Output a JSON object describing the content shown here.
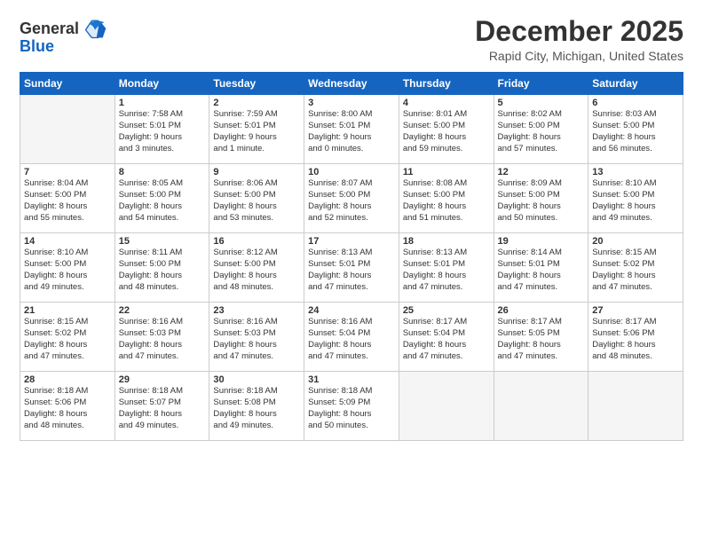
{
  "header": {
    "logo_line1": "General",
    "logo_line2": "Blue",
    "month": "December 2025",
    "location": "Rapid City, Michigan, United States"
  },
  "weekdays": [
    "Sunday",
    "Monday",
    "Tuesday",
    "Wednesday",
    "Thursday",
    "Friday",
    "Saturday"
  ],
  "weeks": [
    [
      {
        "day": "",
        "info": ""
      },
      {
        "day": "1",
        "info": "Sunrise: 7:58 AM\nSunset: 5:01 PM\nDaylight: 9 hours\nand 3 minutes."
      },
      {
        "day": "2",
        "info": "Sunrise: 7:59 AM\nSunset: 5:01 PM\nDaylight: 9 hours\nand 1 minute."
      },
      {
        "day": "3",
        "info": "Sunrise: 8:00 AM\nSunset: 5:01 PM\nDaylight: 9 hours\nand 0 minutes."
      },
      {
        "day": "4",
        "info": "Sunrise: 8:01 AM\nSunset: 5:00 PM\nDaylight: 8 hours\nand 59 minutes."
      },
      {
        "day": "5",
        "info": "Sunrise: 8:02 AM\nSunset: 5:00 PM\nDaylight: 8 hours\nand 57 minutes."
      },
      {
        "day": "6",
        "info": "Sunrise: 8:03 AM\nSunset: 5:00 PM\nDaylight: 8 hours\nand 56 minutes."
      }
    ],
    [
      {
        "day": "7",
        "info": "Sunrise: 8:04 AM\nSunset: 5:00 PM\nDaylight: 8 hours\nand 55 minutes."
      },
      {
        "day": "8",
        "info": "Sunrise: 8:05 AM\nSunset: 5:00 PM\nDaylight: 8 hours\nand 54 minutes."
      },
      {
        "day": "9",
        "info": "Sunrise: 8:06 AM\nSunset: 5:00 PM\nDaylight: 8 hours\nand 53 minutes."
      },
      {
        "day": "10",
        "info": "Sunrise: 8:07 AM\nSunset: 5:00 PM\nDaylight: 8 hours\nand 52 minutes."
      },
      {
        "day": "11",
        "info": "Sunrise: 8:08 AM\nSunset: 5:00 PM\nDaylight: 8 hours\nand 51 minutes."
      },
      {
        "day": "12",
        "info": "Sunrise: 8:09 AM\nSunset: 5:00 PM\nDaylight: 8 hours\nand 50 minutes."
      },
      {
        "day": "13",
        "info": "Sunrise: 8:10 AM\nSunset: 5:00 PM\nDaylight: 8 hours\nand 49 minutes."
      }
    ],
    [
      {
        "day": "14",
        "info": "Sunrise: 8:10 AM\nSunset: 5:00 PM\nDaylight: 8 hours\nand 49 minutes."
      },
      {
        "day": "15",
        "info": "Sunrise: 8:11 AM\nSunset: 5:00 PM\nDaylight: 8 hours\nand 48 minutes."
      },
      {
        "day": "16",
        "info": "Sunrise: 8:12 AM\nSunset: 5:00 PM\nDaylight: 8 hours\nand 48 minutes."
      },
      {
        "day": "17",
        "info": "Sunrise: 8:13 AM\nSunset: 5:01 PM\nDaylight: 8 hours\nand 47 minutes."
      },
      {
        "day": "18",
        "info": "Sunrise: 8:13 AM\nSunset: 5:01 PM\nDaylight: 8 hours\nand 47 minutes."
      },
      {
        "day": "19",
        "info": "Sunrise: 8:14 AM\nSunset: 5:01 PM\nDaylight: 8 hours\nand 47 minutes."
      },
      {
        "day": "20",
        "info": "Sunrise: 8:15 AM\nSunset: 5:02 PM\nDaylight: 8 hours\nand 47 minutes."
      }
    ],
    [
      {
        "day": "21",
        "info": "Sunrise: 8:15 AM\nSunset: 5:02 PM\nDaylight: 8 hours\nand 47 minutes."
      },
      {
        "day": "22",
        "info": "Sunrise: 8:16 AM\nSunset: 5:03 PM\nDaylight: 8 hours\nand 47 minutes."
      },
      {
        "day": "23",
        "info": "Sunrise: 8:16 AM\nSunset: 5:03 PM\nDaylight: 8 hours\nand 47 minutes."
      },
      {
        "day": "24",
        "info": "Sunrise: 8:16 AM\nSunset: 5:04 PM\nDaylight: 8 hours\nand 47 minutes."
      },
      {
        "day": "25",
        "info": "Sunrise: 8:17 AM\nSunset: 5:04 PM\nDaylight: 8 hours\nand 47 minutes."
      },
      {
        "day": "26",
        "info": "Sunrise: 8:17 AM\nSunset: 5:05 PM\nDaylight: 8 hours\nand 47 minutes."
      },
      {
        "day": "27",
        "info": "Sunrise: 8:17 AM\nSunset: 5:06 PM\nDaylight: 8 hours\nand 48 minutes."
      }
    ],
    [
      {
        "day": "28",
        "info": "Sunrise: 8:18 AM\nSunset: 5:06 PM\nDaylight: 8 hours\nand 48 minutes."
      },
      {
        "day": "29",
        "info": "Sunrise: 8:18 AM\nSunset: 5:07 PM\nDaylight: 8 hours\nand 49 minutes."
      },
      {
        "day": "30",
        "info": "Sunrise: 8:18 AM\nSunset: 5:08 PM\nDaylight: 8 hours\nand 49 minutes."
      },
      {
        "day": "31",
        "info": "Sunrise: 8:18 AM\nSunset: 5:09 PM\nDaylight: 8 hours\nand 50 minutes."
      },
      {
        "day": "",
        "info": ""
      },
      {
        "day": "",
        "info": ""
      },
      {
        "day": "",
        "info": ""
      }
    ]
  ]
}
